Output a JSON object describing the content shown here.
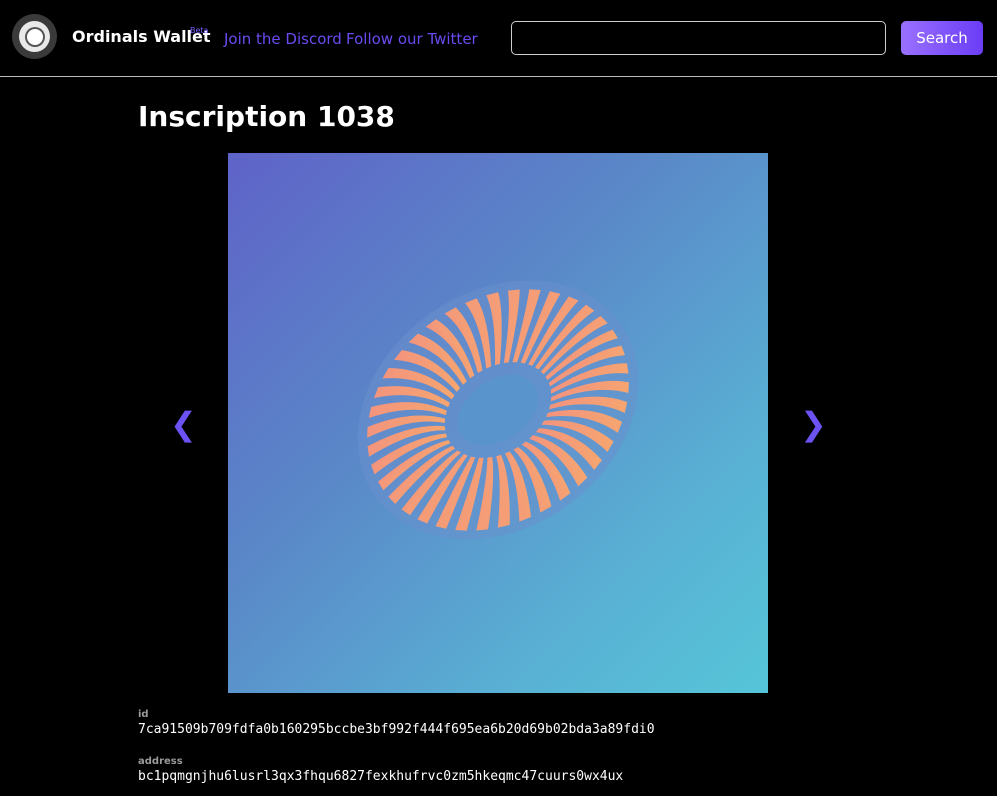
{
  "header": {
    "brand": "Ordinals Wallet",
    "beta_badge": "Beta",
    "links": [
      {
        "label": "Join the Discord"
      },
      {
        "label": "Follow our Twitter"
      }
    ],
    "search": {
      "placeholder": "",
      "value": "",
      "button_label": "Search"
    }
  },
  "inscription": {
    "title": "Inscription 1038",
    "prev_icon": "chevron-left-icon",
    "next_icon": "chevron-right-icon",
    "prev_glyph": "❮",
    "next_glyph": "❯",
    "fields": {
      "id_label": "id",
      "id_value": "7ca91509b709fdfa0b160295bccbe3bf992f444f695ea6b20d69b02bda3a89fdi0",
      "address_label": "address",
      "address_value": "bc1pqmgnjhu6lusrl3qx3fhqu6827fexkhufrvc0zm5hkeqmc47cuurs0wx4ux"
    }
  },
  "colors": {
    "accent": "#6b4bf0",
    "background": "#000000",
    "stripe": "#f08c78",
    "gradient_start": "#5f63c8",
    "gradient_end": "#56c5d8"
  }
}
